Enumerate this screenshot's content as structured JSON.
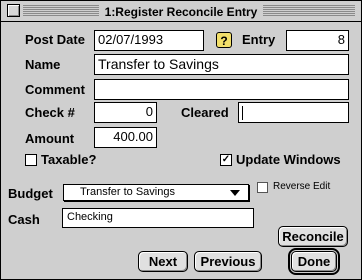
{
  "window": {
    "title": "1:Register Reconcile Entry"
  },
  "form": {
    "post_date_label": "Post Date",
    "post_date_value": "02/07/1993",
    "help_glyph": "?",
    "entry_label": "Entry",
    "entry_value": "8",
    "name_label": "Name",
    "name_value": "Transfer to Savings",
    "comment_label": "Comment",
    "comment_value": "",
    "check_label": "Check #",
    "check_value": "0",
    "cleared_label": "Cleared",
    "cleared_value": "",
    "amount_label": "Amount",
    "amount_value": "400.00",
    "taxable_label": "Taxable?",
    "taxable_checked": false,
    "update_label": "Update Windows",
    "update_checked": true,
    "budget_label": "Budget",
    "budget_value": "Transfer to Savings",
    "reverse_edit_label": "Reverse Edit",
    "reverse_edit_checked": false,
    "cash_label": "Cash",
    "cash_value": "Checking"
  },
  "buttons": {
    "reconcile": "Reconcile",
    "next": "Next",
    "previous": "Previous",
    "done": "Done"
  },
  "icons": {
    "help": "help-icon",
    "close": "close-box-icon",
    "popup_arrow": "triangle-down-icon"
  }
}
